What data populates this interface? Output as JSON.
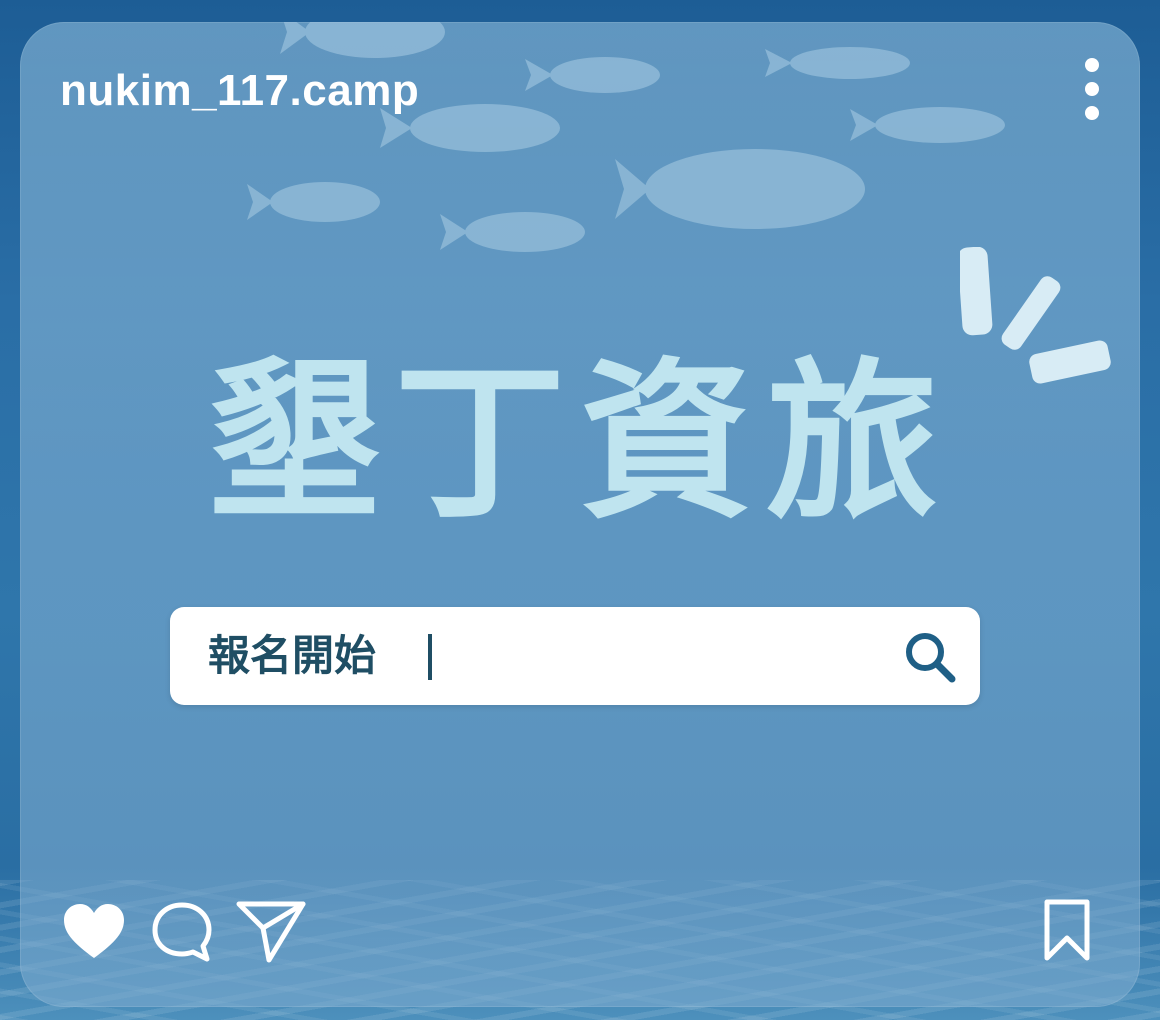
{
  "post": {
    "username": "nukim_117.camp",
    "headline": "墾丁資旅",
    "search": {
      "value": "報名開始"
    }
  },
  "icons": {
    "more": "more-vertical-icon",
    "search": "magnifier-icon",
    "like": "heart-icon",
    "comment": "comment-bubble-icon",
    "share": "paper-plane-icon",
    "save": "bookmark-icon"
  },
  "colors": {
    "headline": "#bfe4ef",
    "search_text": "#1f4e64",
    "icon_white": "#ffffff",
    "ocean": "#2a6ea6"
  }
}
